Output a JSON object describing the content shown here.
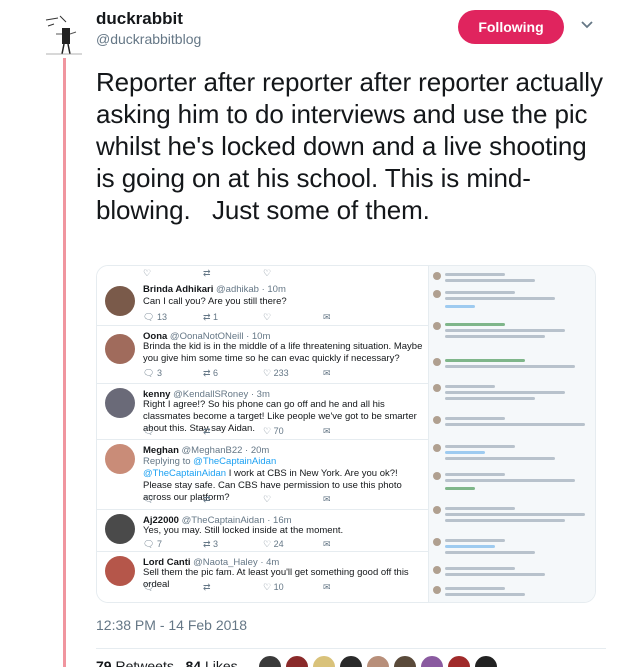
{
  "author": {
    "display_name": "duckrabbit",
    "handle": "@duckrabbitblog"
  },
  "follow_button": {
    "label": "Following",
    "color": "#e0245e"
  },
  "tweet": {
    "text": "Reporter after reporter after reporter actually asking him to do interviews and use the pic whilst he's locked down and a live shooting is going on at his school. This is mind-blowing.   Just some of them.",
    "timestamp": "12:38 PM - 14 Feb 2018"
  },
  "stats": {
    "retweets": "79",
    "retweets_label": "Retweets",
    "likes": "84",
    "likes_label": "Likes"
  },
  "accent_colors": {
    "thread_line": "#f0959f",
    "link": "#1da1f2",
    "muted": "#657786"
  },
  "embedded_screenshot": {
    "tweets": [
      {
        "name": "Brinda Adhikari",
        "meta": "@adhikab · 10m",
        "body": "Can I call you? Are you still there?",
        "actions": [
          "13",
          "1",
          "",
          ""
        ]
      },
      {
        "name": "Oona",
        "meta": "@OonaNotONeill · 10m",
        "body": "Brinda the kid is in the middle of a life threatening situation.  Maybe you give him some time so he can evac quickly if necessary?",
        "actions": [
          "3",
          "6",
          "233",
          ""
        ]
      },
      {
        "name": "kenny",
        "meta": "@KendallSRoney · 3m",
        "body": "Right I agree!? So his phone can go off and he and all his classmates become a target! Like people we've got to be smarter about this. Stay say Aidan.",
        "actions": [
          "",
          "",
          "70",
          ""
        ]
      },
      {
        "name": "Meghan",
        "meta": "@MeghanB22 · 20m",
        "reply_prefix": "Replying to",
        "reply_to": "@TheCaptainAidan",
        "body_link": "@TheCaptainAidan",
        "body": " I work at CBS in New York. Are you ok?! Please stay safe. Can CBS have permission to use this photo across our platform?",
        "actions": [
          "",
          "",
          "",
          ""
        ]
      },
      {
        "name": "Aj22000",
        "meta": "@TheCaptainAidan · 16m",
        "body": "Yes, you may. Still locked inside at the moment.",
        "actions": [
          "7",
          "3",
          "24",
          ""
        ]
      },
      {
        "name": "Lord Canti",
        "meta": "@Naota_Haley · 4m",
        "body": "Sell them the pic fam. At least you'll get something good off this ordeal",
        "actions": [
          "",
          "",
          "10",
          ""
        ]
      }
    ]
  }
}
